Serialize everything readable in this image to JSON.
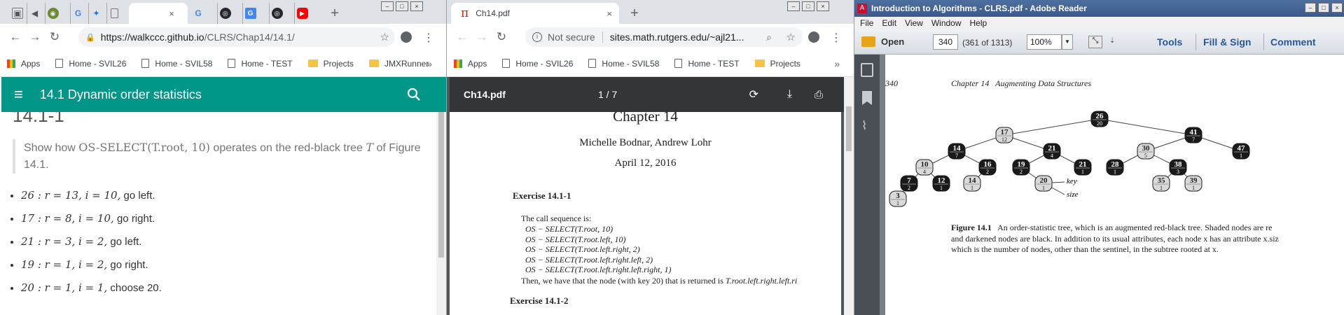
{
  "w1": {
    "tab_close": "×",
    "new_tab": "+",
    "url_host": "https://walkccc.github.io",
    "url_path": "/CLRS/Chap14/14.1/",
    "bookmarks": [
      "Apps",
      "Home - SVIL26",
      "Home - SVIL58",
      "Home - TEST",
      "Projects",
      "JMXRunner"
    ],
    "more_bookmarks": "»",
    "appbar_title": "14.1 Dynamic order statistics",
    "heading": "14.1-1",
    "question_a": "Show how ",
    "question_math": "OS-SELECT(T.root, 10)",
    "question_b": " operates on the red-black tree ",
    "question_t": "T",
    "question_c": " of Figure 14.1.",
    "steps": [
      {
        "math": "26 : r = 13, i = 10,",
        "text": " go left."
      },
      {
        "math": "17 : r = 8, i = 10,",
        "text": " go right."
      },
      {
        "math": "21 : r = 3, i = 2,",
        "text": " go left."
      },
      {
        "math": "19 : r = 1, i = 2,",
        "text": " go right."
      },
      {
        "math": "20 : r = 1, i = 1,",
        "text": " choose 20."
      }
    ]
  },
  "w2": {
    "tab_title": "Ch14.pdf",
    "tab_close": "×",
    "new_tab": "+",
    "not_secure": "Not secure",
    "url": "sites.math.rutgers.edu/~ajl21...",
    "bookmarks": [
      "Apps",
      "Home - SVIL26",
      "Home - SVIL58",
      "Home - TEST",
      "Projects"
    ],
    "more_bookmarks": "»",
    "pdf_title": "Ch14.pdf",
    "page_indicator": "1 / 7",
    "chapter": "Chapter 14",
    "authors": "Michelle Bodnar, Andrew Lohr",
    "date": "April 12, 2016",
    "exercise1": "Exercise 14.1-1",
    "call_intro": "The call sequence is:",
    "calls": [
      "OS − SELECT(T.root, 10)",
      "OS − SELECT(T.root.left, 10)",
      "OS − SELECT(T.root.left.right, 2)",
      "OS − SELECT(T.root.left.right.left, 2)",
      "OS − SELECT(T.root.left.right.left.right, 1)"
    ],
    "result_text": "Then, we have that the node (with key 20) that is returned is ",
    "result_math": "T.root.left.right.left.ri",
    "exercise2": "Exercise 14.1-2"
  },
  "w3": {
    "title": "Introduction to Algorithms - CLRS.pdf - Adobe Reader",
    "menu": [
      "File",
      "Edit",
      "View",
      "Window",
      "Help"
    ],
    "open_label": "Open",
    "page_value": "340",
    "page_count": "(361 of 1313)",
    "zoom": "100%",
    "tools": "Tools",
    "fill_sign": "Fill & Sign",
    "comment": "Comment",
    "page_number": "340",
    "running_head": "Chapter 14   Augmenting Data Structures",
    "label_key": "key",
    "label_size": "size",
    "caption_bold": "Figure 14.1",
    "caption_lines": [
      "An order-statistic tree, which is an augmented red-black tree. Shaded nodes are re",
      "and darkened nodes are black. In addition to its usual attributes, each node x has an attribute x.siz",
      "which is the number of nodes, other than the sentinel, in the subtree rooted at x."
    ],
    "nodes": [
      {
        "key": "26",
        "size": "20",
        "black": true
      },
      {
        "key": "17",
        "size": "12",
        "black": false
      },
      {
        "key": "41",
        "size": "7",
        "black": true
      },
      {
        "key": "14",
        "size": "7",
        "black": true
      },
      {
        "key": "21",
        "size": "4",
        "black": true
      },
      {
        "key": "30",
        "size": "5",
        "black": false
      },
      {
        "key": "47",
        "size": "1",
        "black": true
      },
      {
        "key": "10",
        "size": "4",
        "black": false
      },
      {
        "key": "16",
        "size": "2",
        "black": true
      },
      {
        "key": "19",
        "size": "2",
        "black": true
      },
      {
        "key": "21",
        "size": "1",
        "black": true
      },
      {
        "key": "28",
        "size": "1",
        "black": true
      },
      {
        "key": "38",
        "size": "3",
        "black": true
      },
      {
        "key": "7",
        "size": "2",
        "black": true
      },
      {
        "key": "12",
        "size": "1",
        "black": true
      },
      {
        "key": "14",
        "size": "1",
        "black": false
      },
      {
        "key": "20",
        "size": "1",
        "black": false
      },
      {
        "key": "35",
        "size": "1",
        "black": false
      },
      {
        "key": "39",
        "size": "1",
        "black": false
      },
      {
        "key": "3",
        "size": "1",
        "black": false
      }
    ]
  }
}
